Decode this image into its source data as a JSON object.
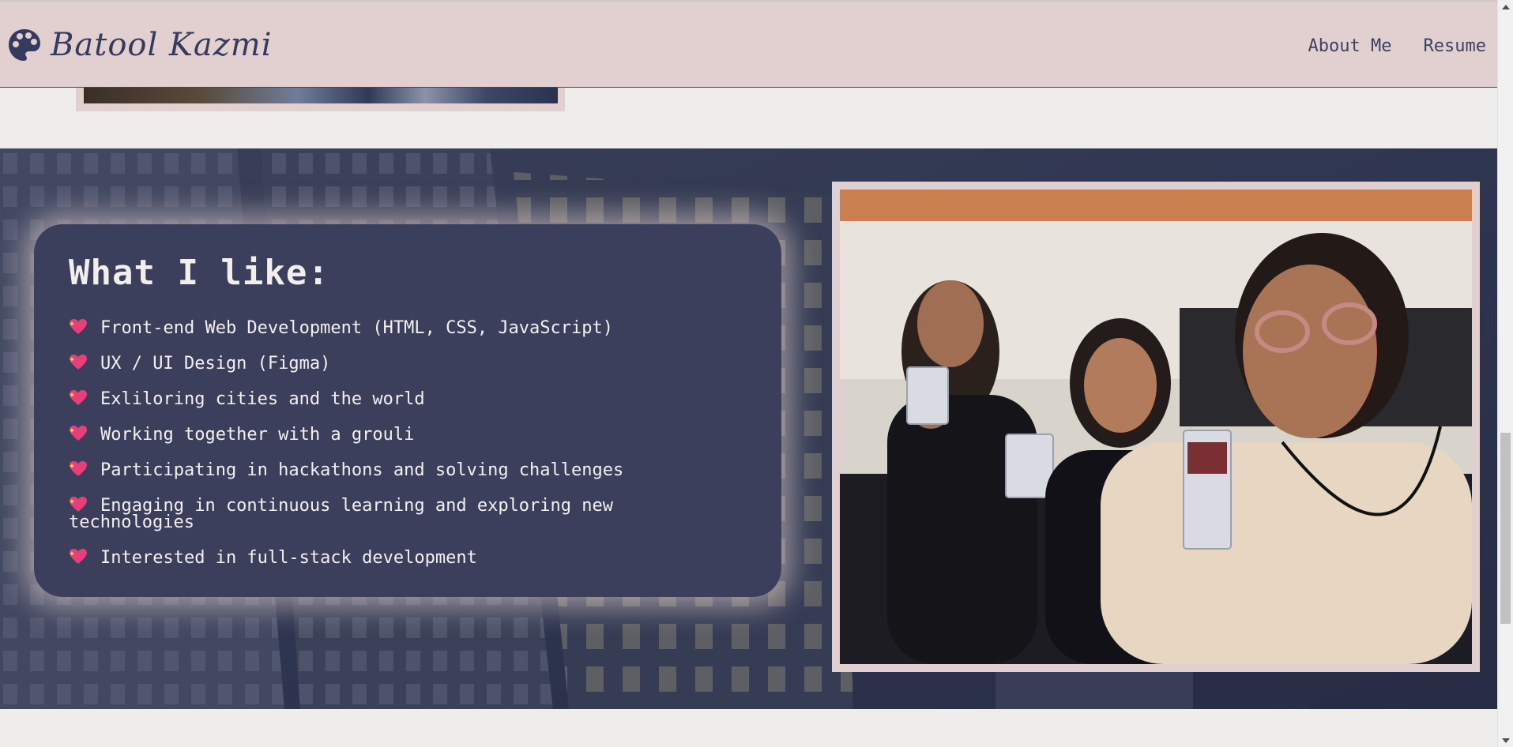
{
  "header": {
    "brand_name": "Batool Kazmi",
    "brand_icon": "palette-icon",
    "nav": [
      {
        "label": "About Me"
      },
      {
        "label": "Resume"
      }
    ]
  },
  "likes": {
    "title": "What I like:",
    "bullet_icon": "sparkling-heart-icon",
    "items": [
      "Front-end Web Development (HTML, CSS, JavaScript)",
      "UX / UI Design (Figma)",
      "Exliloring cities and the world",
      "Working together with a grouli",
      "Participating in hackathons and solving challenges",
      "Engaging in continuous learning and exploring new technologies",
      "Interested in full-stack development"
    ]
  },
  "colors": {
    "header_bg": "#e2cfd0",
    "brand_text": "#363a5c",
    "band_bg": "#2c3352",
    "card_bg": "#3c3f5c",
    "card_glow": "#e2cfd0",
    "page_bg": "#efedeb"
  }
}
